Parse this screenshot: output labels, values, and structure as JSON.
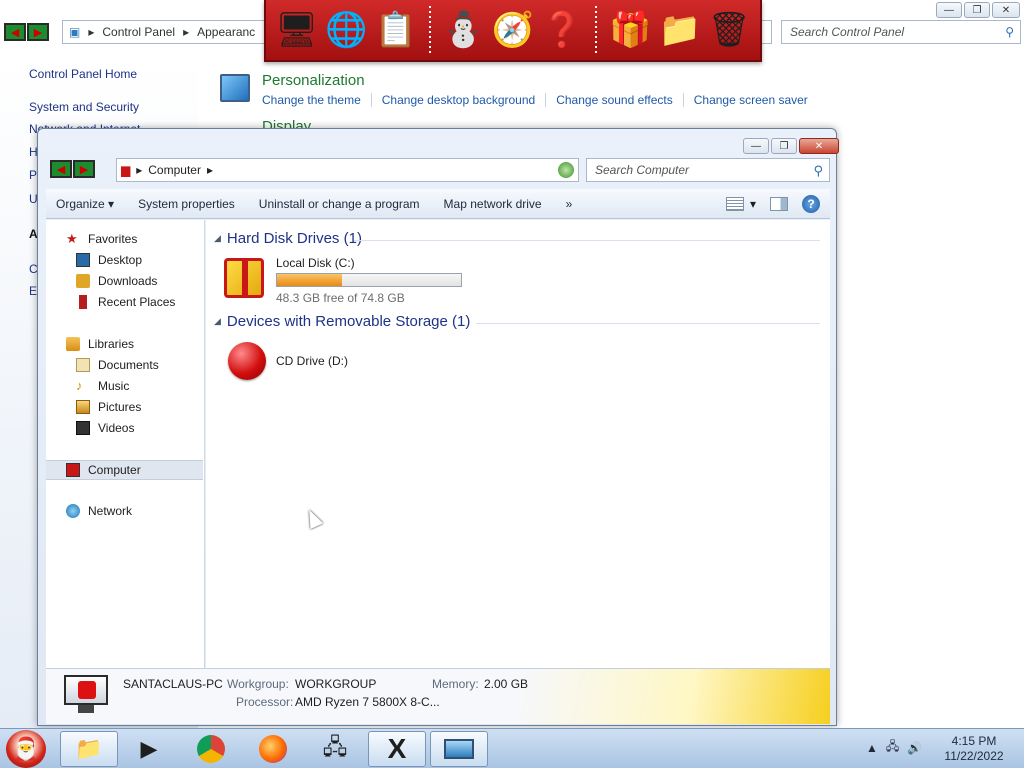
{
  "control_panel": {
    "address_path": "Control Panel",
    "address_next": "Appearanc",
    "search_placeholder": "Search Control Panel",
    "left_links": [
      "Control Panel Home",
      "System and Security",
      "Network and Internet",
      "H",
      "P",
      "U",
      "A",
      "C",
      "E"
    ],
    "personalization": {
      "title": "Personalization",
      "links": [
        "Change the theme",
        "Change desktop background",
        "Change sound effects",
        "Change screen saver"
      ]
    },
    "display_title": "Display"
  },
  "dock": {
    "items": [
      "computer-icon",
      "globe-icon",
      "notepad-icon",
      "snowman-icon",
      "control-panel-icon",
      "help-icon",
      "gift-icon",
      "folder-icon",
      "recycle-bin-icon"
    ],
    "glyphs": [
      "🖥",
      "🌐",
      "📋",
      "⛄",
      "🧭",
      "❓",
      "🎁",
      "📁",
      "🗑"
    ]
  },
  "explorer": {
    "address_path": "Computer",
    "search_placeholder": "Search Computer",
    "toolbar": {
      "organize": "Organize",
      "system_properties": "System properties",
      "uninstall": "Uninstall or change a program",
      "map_drive": "Map network drive",
      "more": "»"
    },
    "nav": {
      "favorites": "Favorites",
      "desktop": "Desktop",
      "downloads": "Downloads",
      "recent_places": "Recent Places",
      "libraries": "Libraries",
      "documents": "Documents",
      "music": "Music",
      "pictures": "Pictures",
      "videos": "Videos",
      "computer": "Computer",
      "network": "Network"
    },
    "groups": {
      "hdd_title": "Hard Disk Drives (1)",
      "removable_title": "Devices with Removable Storage (1)"
    },
    "drives": {
      "local_disk": {
        "name": "Local Disk (C:)",
        "free_text": "48.3 GB free of 74.8 GB",
        "used_fraction": 0.354
      },
      "cd_drive": {
        "name": "CD Drive (D:)"
      }
    },
    "details": {
      "pc_name": "SANTACLAUS-PC",
      "workgroup_label": "Workgroup:",
      "workgroup_value": "WORKGROUP",
      "memory_label": "Memory:",
      "memory_value": "2.00 GB",
      "processor_label": "Processor:",
      "processor_value": "AMD Ryzen 7 5800X 8-C..."
    }
  },
  "taskbar": {
    "apps": [
      "folder-icon",
      "media-player-icon",
      "chrome-icon",
      "firefox-icon",
      "network-icon",
      "x-app-icon",
      "display-icon"
    ],
    "time": "4:15 PM",
    "date": "11/22/2022"
  },
  "colors": {
    "dock_red": "#c41a1a",
    "link_blue": "#1e5aa8",
    "title_green": "#1e7a2f",
    "nav_green": "#1d8c2e"
  }
}
